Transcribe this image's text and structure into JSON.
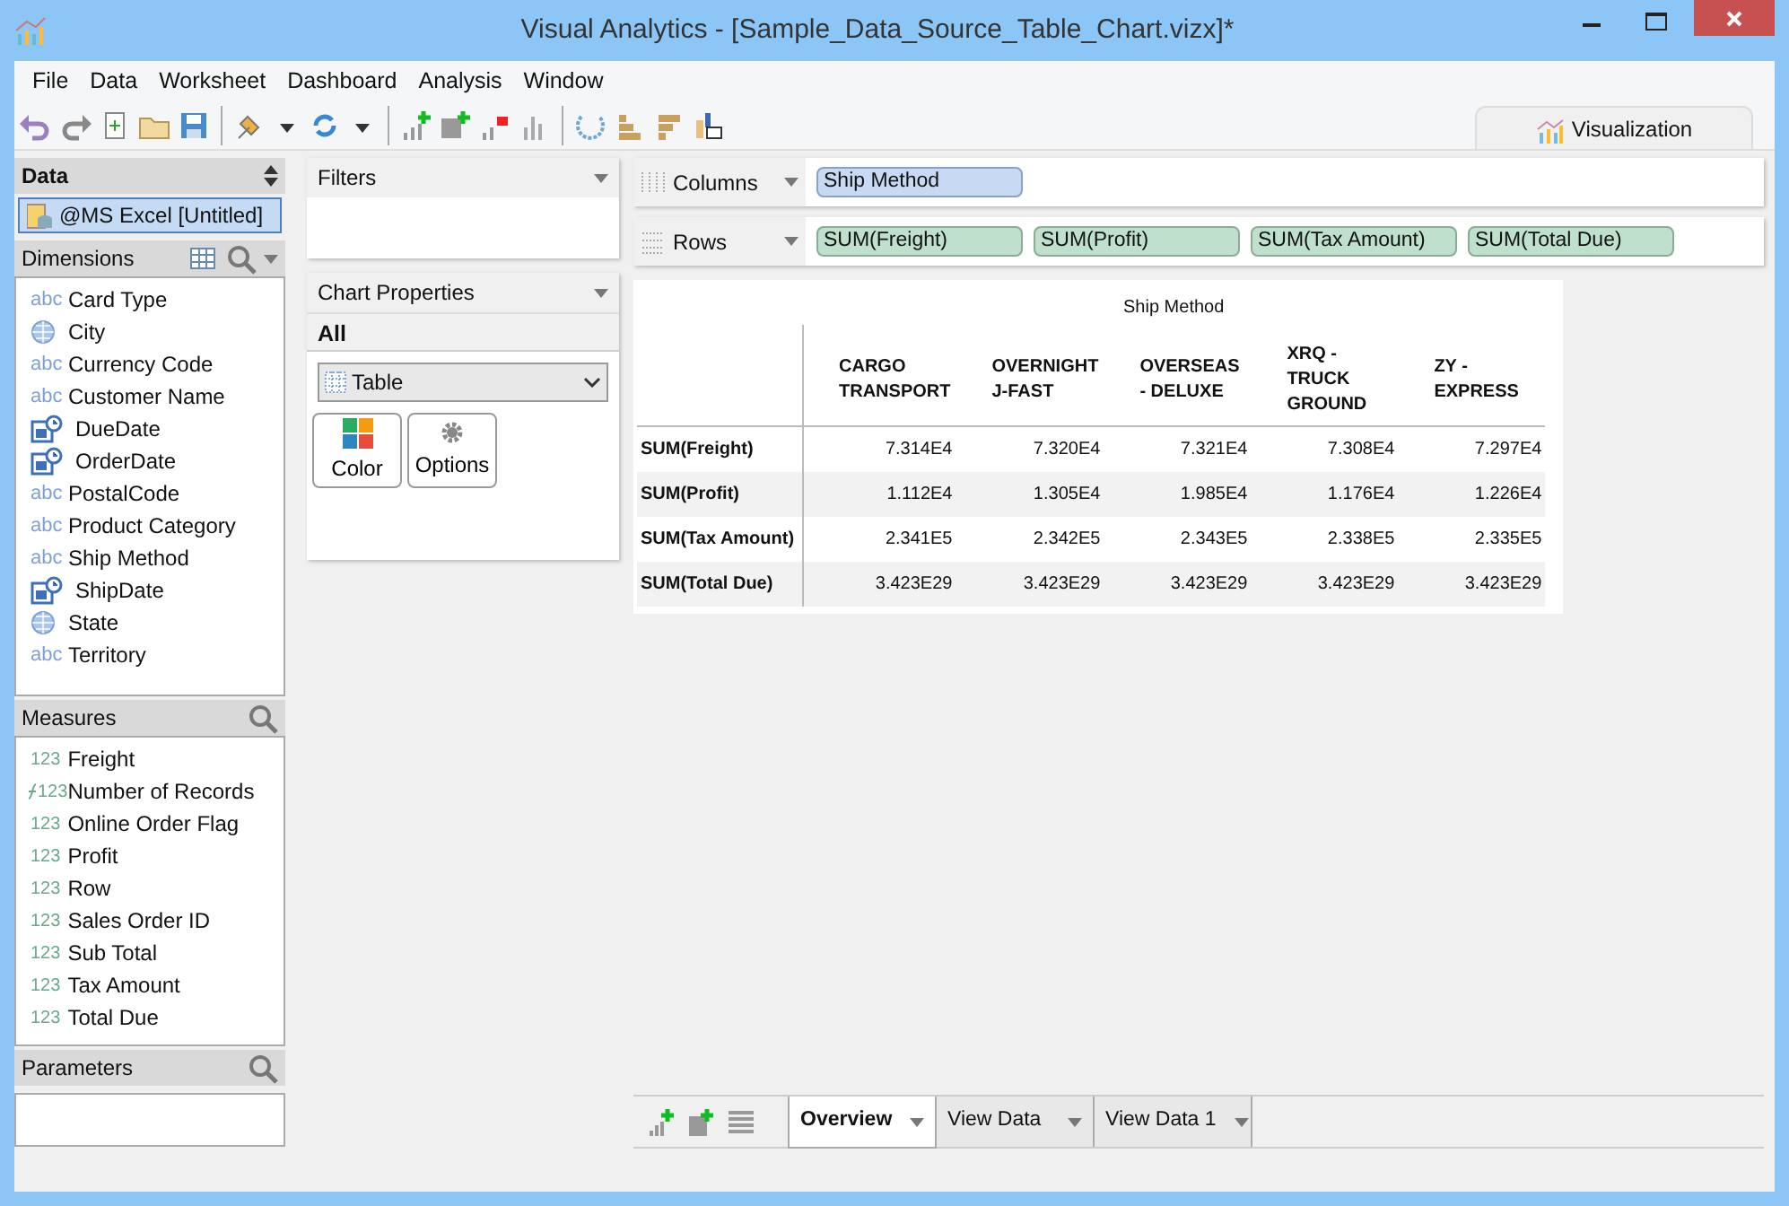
{
  "window": {
    "title": "Visual Analytics - [Sample_Data_Source_Table_Chart.vizx]*"
  },
  "menu": [
    "File",
    "Data",
    "Worksheet",
    "Dashboard",
    "Analysis",
    "Window"
  ],
  "view_tab": {
    "label": "Visualization"
  },
  "data_panel": {
    "title": "Data",
    "source": "@MS Excel [Untitled]",
    "dimensions": {
      "title": "Dimensions",
      "items": [
        {
          "kind": "text",
          "badge": "abc",
          "label": "Card Type"
        },
        {
          "kind": "geo",
          "label": "City"
        },
        {
          "kind": "text",
          "badge": "abc",
          "label": "Currency Code"
        },
        {
          "kind": "text",
          "badge": "abc",
          "label": "Customer Name"
        },
        {
          "kind": "date",
          "label": "DueDate"
        },
        {
          "kind": "date",
          "label": "OrderDate"
        },
        {
          "kind": "text",
          "badge": "abc",
          "label": "PostalCode"
        },
        {
          "kind": "text",
          "badge": "abc",
          "label": "Product Category"
        },
        {
          "kind": "text",
          "badge": "abc",
          "label": "Ship Method"
        },
        {
          "kind": "date",
          "label": "ShipDate"
        },
        {
          "kind": "geo",
          "label": "State"
        },
        {
          "kind": "text",
          "badge": "abc",
          "label": "Territory"
        }
      ]
    },
    "measures": {
      "title": "Measures",
      "items": [
        {
          "kind": "number",
          "badge": "123",
          "label": "Freight"
        },
        {
          "kind": "calc",
          "badge": "123",
          "label": "Number of Records"
        },
        {
          "kind": "number",
          "badge": "123",
          "label": "Online Order Flag"
        },
        {
          "kind": "number",
          "badge": "123",
          "label": "Profit"
        },
        {
          "kind": "number",
          "badge": "123",
          "label": "Row"
        },
        {
          "kind": "number",
          "badge": "123",
          "label": "Sales Order ID"
        },
        {
          "kind": "number",
          "badge": "123",
          "label": "Sub Total"
        },
        {
          "kind": "number",
          "badge": "123",
          "label": "Tax Amount"
        },
        {
          "kind": "number",
          "badge": "123",
          "label": "Total Due"
        }
      ]
    },
    "parameters": {
      "title": "Parameters"
    }
  },
  "filters": {
    "title": "Filters"
  },
  "chart_properties": {
    "title": "Chart Properties",
    "group": "All",
    "chart_type": "Table",
    "buttons": [
      {
        "kind": "color",
        "label": "Color"
      },
      {
        "kind": "options",
        "label": "Options"
      }
    ]
  },
  "shelves": [
    {
      "kind": "columns",
      "label": "Columns",
      "pills": [
        "Ship Method"
      ]
    },
    {
      "kind": "rows",
      "label": "Rows",
      "pills": [
        "SUM(Freight)",
        "SUM(Profit)",
        "SUM(Tax Amount)",
        "SUM(Total Due)"
      ]
    }
  ],
  "table": {
    "header": "Ship Method",
    "columns": [
      "CARGO TRANSPORT",
      "OVERNIGHT J-FAST",
      "OVERSEAS - DELUXE",
      "XRQ - TRUCK GROUND",
      "ZY - EXPRESS"
    ],
    "rows": [
      {
        "label": "SUM(Freight)",
        "cells": [
          "7.314E4",
          "7.320E4",
          "7.321E4",
          "7.308E4",
          "7.297E4"
        ]
      },
      {
        "label": "SUM(Profit)",
        "cells": [
          "1.112E4",
          "1.305E4",
          "1.985E4",
          "1.176E4",
          "1.226E4"
        ]
      },
      {
        "label": "SUM(Tax Amount)",
        "cells": [
          "2.341E5",
          "2.342E5",
          "2.343E5",
          "2.338E5",
          "2.335E5"
        ]
      },
      {
        "label": "SUM(Total Due)",
        "cells": [
          "3.423E29",
          "3.423E29",
          "3.423E29",
          "3.423E29",
          "3.423E29"
        ]
      }
    ]
  },
  "sheet_tabs": [
    {
      "label": "Overview",
      "selected": true
    },
    {
      "label": "View Data",
      "selected": false
    },
    {
      "label": "View Data 1",
      "selected": false
    }
  ]
}
